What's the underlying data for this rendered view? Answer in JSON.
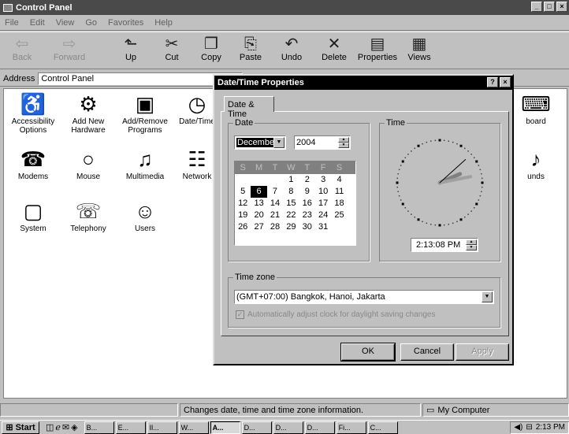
{
  "window": {
    "title": "Control Panel",
    "controls": [
      "_",
      "□",
      "×"
    ]
  },
  "menu": [
    "File",
    "Edit",
    "View",
    "Go",
    "Favorites",
    "Help"
  ],
  "toolbar": [
    {
      "label": "Back",
      "icon": "back-arrow-icon",
      "glyph": "⇦",
      "enabled": false
    },
    {
      "label": "Forward",
      "icon": "forward-arrow-icon",
      "glyph": "⇨",
      "enabled": false
    },
    {
      "label": "Up",
      "icon": "folder-up-icon",
      "glyph": "⬑",
      "enabled": true
    },
    {
      "label": "Cut",
      "icon": "scissors-icon",
      "glyph": "✂",
      "enabled": true
    },
    {
      "label": "Copy",
      "icon": "copy-icon",
      "glyph": "❐",
      "enabled": true
    },
    {
      "label": "Paste",
      "icon": "paste-icon",
      "glyph": "⎘",
      "enabled": true
    },
    {
      "label": "Undo",
      "icon": "undo-icon",
      "glyph": "↶",
      "enabled": true
    },
    {
      "label": "Delete",
      "icon": "delete-icon",
      "glyph": "✕",
      "enabled": true
    },
    {
      "label": "Properties",
      "icon": "properties-icon",
      "glyph": "▤",
      "enabled": true
    },
    {
      "label": "Views",
      "icon": "views-icon",
      "glyph": "▦",
      "enabled": true
    }
  ],
  "address": {
    "label": "Address",
    "value": "Control Panel"
  },
  "items": [
    {
      "label": "Accessibility Options",
      "icon": "accessibility-icon",
      "glyph": "♿"
    },
    {
      "label": "Add New Hardware",
      "icon": "hardware-icon",
      "glyph": "⚙"
    },
    {
      "label": "Add/Remove Programs",
      "icon": "programs-icon",
      "glyph": "▣"
    },
    {
      "label": "Date/Time",
      "icon": "calendar-clock-icon",
      "glyph": "◷"
    },
    {
      "label": "board",
      "icon": "keyboard-icon",
      "glyph": "⌨"
    },
    {
      "label": "Modems",
      "icon": "modem-icon",
      "glyph": "☎"
    },
    {
      "label": "Mouse",
      "icon": "mouse-icon",
      "glyph": "○"
    },
    {
      "label": "Multimedia",
      "icon": "multimedia-icon",
      "glyph": "♫"
    },
    {
      "label": "Network",
      "icon": "network-icon",
      "glyph": "☷"
    },
    {
      "label": "unds",
      "icon": "sounds-icon",
      "glyph": "♪"
    },
    {
      "label": "System",
      "icon": "system-icon",
      "glyph": "▢"
    },
    {
      "label": "Telephony",
      "icon": "telephony-icon",
      "glyph": "☏"
    },
    {
      "label": "Users",
      "icon": "users-icon",
      "glyph": "☺"
    }
  ],
  "dialog": {
    "title": "Date/Time Properties",
    "help": "?",
    "close": "×",
    "tab": "Date & Time",
    "date_label": "Date",
    "month": "December",
    "year": "2004",
    "weekdays": [
      "S",
      "M",
      "T",
      "W",
      "T",
      "F",
      "S"
    ],
    "weeks": [
      [
        "",
        "",
        "",
        "1",
        "2",
        "3",
        "4"
      ],
      [
        "5",
        "6",
        "7",
        "8",
        "9",
        "10",
        "11"
      ],
      [
        "12",
        "13",
        "14",
        "15",
        "16",
        "17",
        "18"
      ],
      [
        "19",
        "20",
        "21",
        "22",
        "23",
        "24",
        "25"
      ],
      [
        "26",
        "27",
        "28",
        "29",
        "30",
        "31",
        ""
      ]
    ],
    "selected_day": "6",
    "time_label": "Time",
    "time": "2:13:08 PM",
    "timezone_label": "Time zone",
    "timezone": "(GMT+07:00) Bangkok, Hanoi, Jakarta",
    "dst_text": "Automatically adjust clock for daylight saving changes",
    "dst_checked": true,
    "ok": "OK",
    "cancel": "Cancel",
    "apply": "Apply"
  },
  "status": {
    "text": "Changes date, time and time zone information.",
    "zone": "My Computer"
  },
  "taskbar": {
    "start": "Start",
    "quick": [
      "show-desktop-icon",
      "ie-icon",
      "outlook-icon",
      "channels-icon"
    ],
    "tasks": [
      "B...",
      "E...",
      "Il...",
      "W...",
      "A...",
      "D...",
      "D...",
      "D...",
      "Fi...",
      "C..."
    ],
    "active_task": 4,
    "clock": "2:13 PM"
  }
}
